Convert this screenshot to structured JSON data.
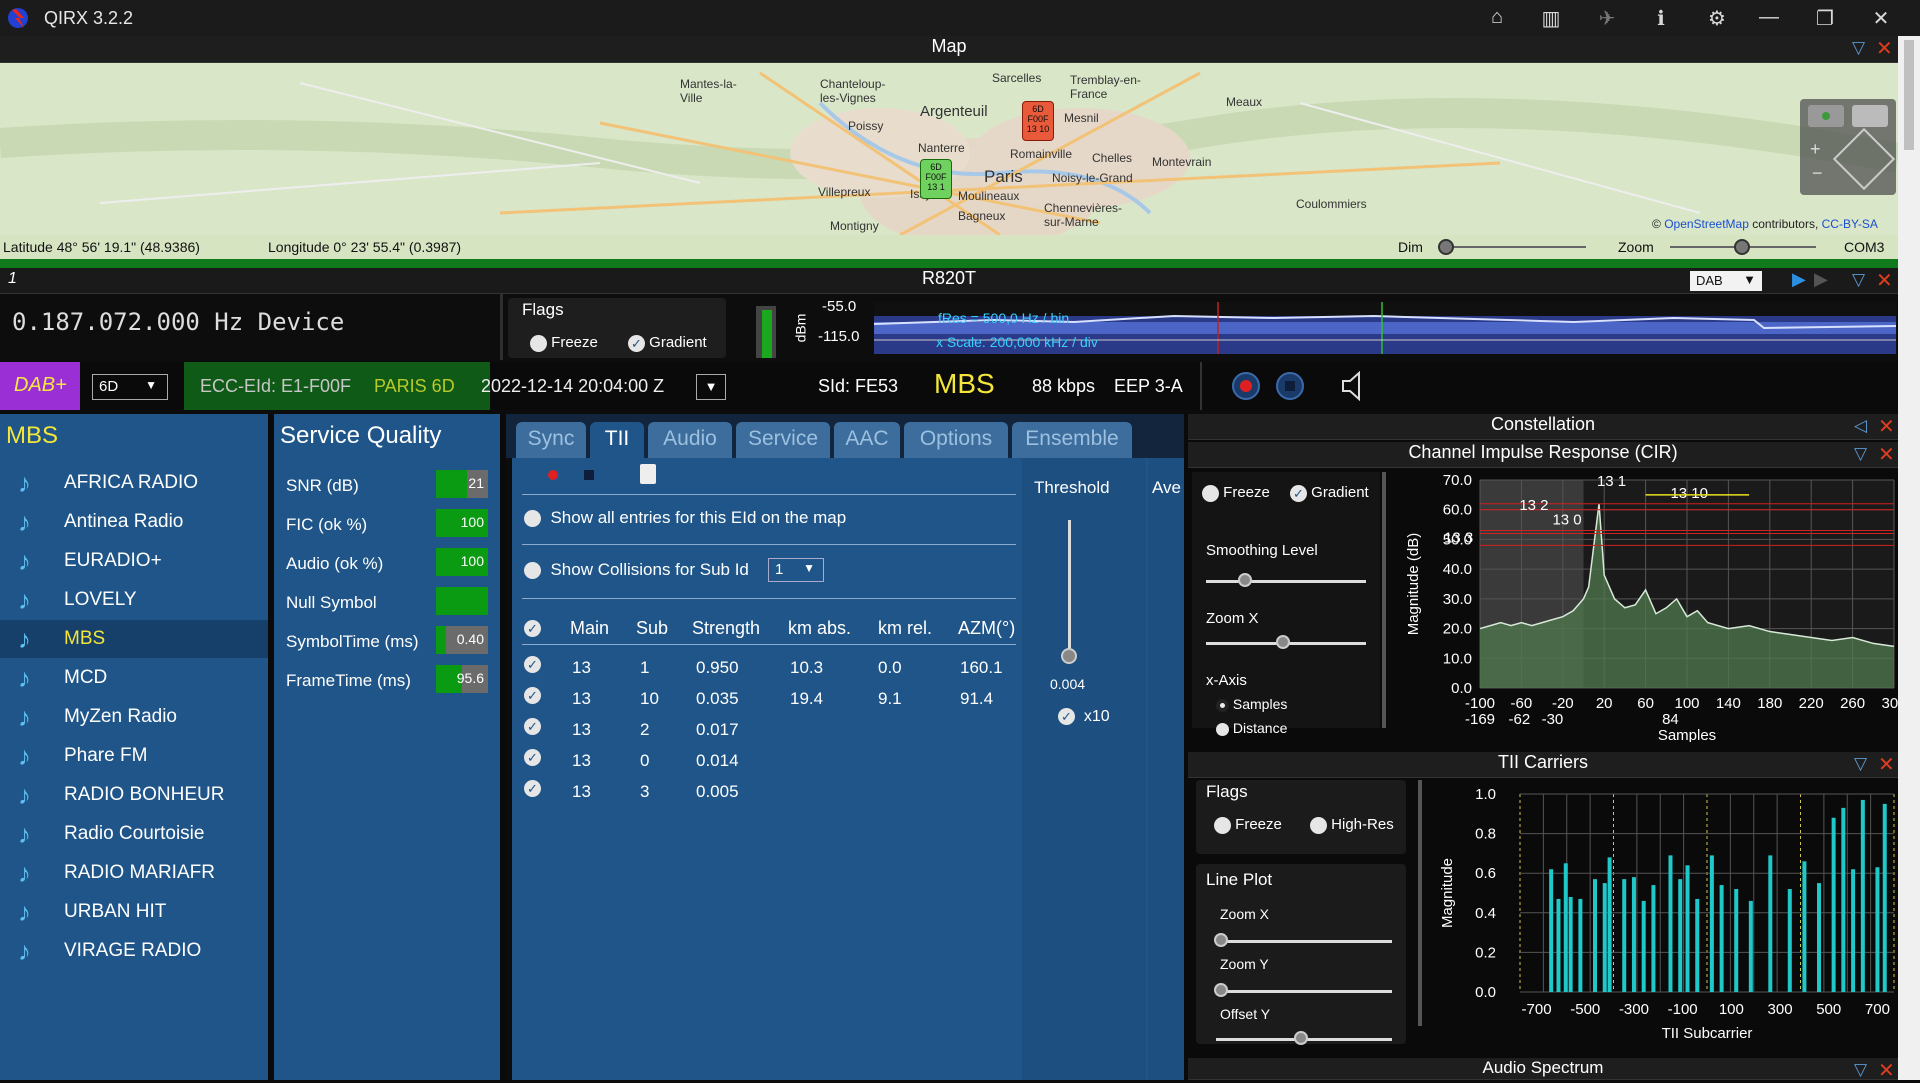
{
  "app": {
    "title": "QIRX 3.2.2"
  },
  "map": {
    "header": "Map",
    "places": [
      "Mantes-la-Ville",
      "Chanteloup-les-Vignes",
      "Sarcelles",
      "Tremblay-en-France",
      "Poissy",
      "Argenteuil",
      "Mesnil",
      "Meaux",
      "Nanterre",
      "Romainville",
      "Chelles",
      "Montevrain",
      "Paris",
      "Noisy-le-Grand",
      "Villepreux",
      "Issy",
      "Moulineaux",
      "Chennevières-sur-Marne",
      "Coulommiers",
      "Bagneux",
      "Montigny"
    ],
    "marker_red": "6D F00F 13 10",
    "marker_green": "6D F00F 13 1",
    "attribution_prefix": "©",
    "attribution_link": "OpenStreetMap",
    "attribution_mid": "contributors,",
    "attribution_license": "CC-BY-SA",
    "latitude": "Latitude  48° 56' 19.1\" (48.9386)",
    "longitude": "Longitude  0° 23' 55.4\" (0.3987)",
    "dim_label": "Dim",
    "zoom_label": "Zoom",
    "com_port": "COM3"
  },
  "device": {
    "header_index": "1",
    "header": "R820T",
    "mode": "DAB",
    "frequency": "0.187.072.000 Hz Device",
    "flags_label": "Flags",
    "freeze": "Freeze",
    "gradient": "Gradient",
    "dbm_top": "-55.0",
    "dbm_bottom": "-115.0",
    "dbm_unit": "dBm",
    "fres": "fRes = 500,0 Hz / bin",
    "xscale": "x Scale: 200,000 kHz / div"
  },
  "dab": {
    "badge": "DAB+",
    "channel": "6D",
    "ecc": "ECC-EId: E1-F00F",
    "ensemble": "PARIS 6D",
    "datetime": "2022-12-14  20:04:00 Z",
    "sid": "SId: FE53",
    "service": "MBS",
    "bitrate": "88 kbps",
    "eep": "EEP 3-A"
  },
  "services": {
    "title": "MBS",
    "items": [
      "AFRICA RADIO",
      "Antinea Radio",
      "EURADIO+",
      "LOVELY",
      "MBS",
      "MCD",
      "MyZen Radio",
      "Phare FM",
      "RADIO BONHEUR",
      "Radio Courtoisie",
      "RADIO MARIAFR",
      "URBAN HIT",
      "VIRAGE RADIO"
    ],
    "selected": 4
  },
  "quality": {
    "title": "Service Quality",
    "rows": [
      {
        "label": "SNR (dB)",
        "value": "21",
        "fill": 0.6
      },
      {
        "label": "FIC (ok %)",
        "value": "100",
        "fill": 1.0
      },
      {
        "label": "Audio (ok %)",
        "value": "100",
        "fill": 1.0
      },
      {
        "label": "Null Symbol",
        "value": "",
        "fill": 1.0
      },
      {
        "label": "SymbolTime (ms)",
        "value": "0.40",
        "fill": 0.2
      },
      {
        "label": "FrameTime (ms)",
        "value": "95.6",
        "fill": 0.5
      }
    ]
  },
  "tii": {
    "tabs": [
      "Sync",
      "TII",
      "Audio",
      "Service",
      "AAC",
      "Options",
      "Ensemble"
    ],
    "active_tab": 1,
    "show_all": "Show all entries for this EId on the map",
    "show_collisions": "Show Collisions for Sub Id",
    "sub_id": "1",
    "columns": [
      "Main",
      "Sub",
      "Strength",
      "km abs.",
      "km rel.",
      "AZM(°)"
    ],
    "rows": [
      [
        "13",
        "1",
        "0.950",
        "10.3",
        "0.0",
        "160.1"
      ],
      [
        "13",
        "10",
        "0.035",
        "19.4",
        "9.1",
        "91.4"
      ],
      [
        "13",
        "2",
        "0.017",
        "",
        "",
        ""
      ],
      [
        "13",
        "0",
        "0.014",
        "",
        "",
        ""
      ],
      [
        "13",
        "3",
        "0.005",
        "",
        "",
        ""
      ]
    ],
    "threshold_label": "Threshold",
    "threshold_value": "0.004",
    "ave_label": "Ave",
    "x10": "x10"
  },
  "constellation": {
    "header": "Constellation"
  },
  "cir": {
    "header": "Channel Impulse Response (CIR)",
    "freeze": "Freeze",
    "gradient": "Gradient",
    "smoothing": "Smoothing Level",
    "zoomx": "Zoom X",
    "xaxis": "x-Axis",
    "samples": "Samples",
    "distance": "Distance",
    "peak_labels": [
      "13 1",
      "13 2",
      "13 0",
      "13 10",
      "13 3"
    ],
    "sub_ticks": [
      "-169",
      "-62",
      "-30",
      "84"
    ]
  },
  "chart_data": [
    {
      "type": "area",
      "title": "Channel Impulse Response (CIR)",
      "xlabel": "Samples",
      "ylabel": "Magnitude (dB)",
      "xlim": [
        -100,
        300
      ],
      "ylim": [
        0,
        70
      ],
      "x_ticks": [
        "-100",
        "-60",
        "-20",
        "20",
        "60",
        "100",
        "140",
        "180",
        "220",
        "260",
        "300"
      ],
      "y_ticks": [
        "0.0",
        "10.0",
        "20.0",
        "30.0",
        "40.0",
        "50.0",
        "60.0",
        "70.0"
      ],
      "x": [
        -100,
        -90,
        -80,
        -70,
        -60,
        -50,
        -40,
        -30,
        -20,
        -10,
        0,
        5,
        10,
        15,
        20,
        30,
        40,
        50,
        60,
        70,
        80,
        90,
        100,
        110,
        120,
        140,
        160,
        180,
        200,
        220,
        240,
        260,
        280,
        300
      ],
      "values": [
        20,
        21,
        22,
        21,
        22,
        21,
        22,
        23,
        24,
        26,
        30,
        34,
        48,
        62,
        38,
        30,
        27,
        28,
        33,
        25,
        27,
        30,
        24,
        26,
        22,
        20,
        21,
        19,
        18,
        17,
        16,
        17,
        15,
        14
      ]
    },
    {
      "type": "bar",
      "title": "TII Carriers",
      "xlabel": "TII Subcarrier",
      "ylabel": "Magnitude",
      "xlim": [
        -768,
        768
      ],
      "ylim": [
        0,
        1.0
      ],
      "x_ticks": [
        "-700",
        "-500",
        "-300",
        "-100",
        "100",
        "300",
        "500",
        "700"
      ],
      "y_ticks": [
        "0.0",
        "0.2",
        "0.4",
        "0.6",
        "0.8",
        "1.0"
      ],
      "x": [
        -640,
        -610,
        -580,
        -560,
        -520,
        -460,
        -420,
        -400,
        -340,
        -300,
        -260,
        -220,
        -150,
        -110,
        -80,
        -40,
        20,
        60,
        120,
        180,
        260,
        340,
        400,
        460,
        520,
        560,
        600,
        640,
        700,
        730
      ],
      "values": [
        0.62,
        0.47,
        0.65,
        0.48,
        0.47,
        0.57,
        0.55,
        0.68,
        0.57,
        0.58,
        0.46,
        0.54,
        0.69,
        0.57,
        0.64,
        0.47,
        0.69,
        0.54,
        0.52,
        0.46,
        0.69,
        0.52,
        0.66,
        0.55,
        0.88,
        0.93,
        0.62,
        0.97,
        0.63,
        0.95
      ]
    }
  ],
  "tii_carriers": {
    "header": "TII Carriers",
    "flags": "Flags",
    "freeze": "Freeze",
    "highres": "High-Res",
    "lineplot": "Line Plot",
    "zoomx": "Zoom X",
    "zoomy": "Zoom Y",
    "offsety": "Offset Y"
  },
  "audio_spectrum": {
    "header": "Audio Spectrum"
  },
  "colors": {
    "panel_blue": "#1f5588",
    "accent_green": "#0a9b12",
    "tii_bar": "#1fc9c9",
    "close_red": "#e03b1d"
  }
}
